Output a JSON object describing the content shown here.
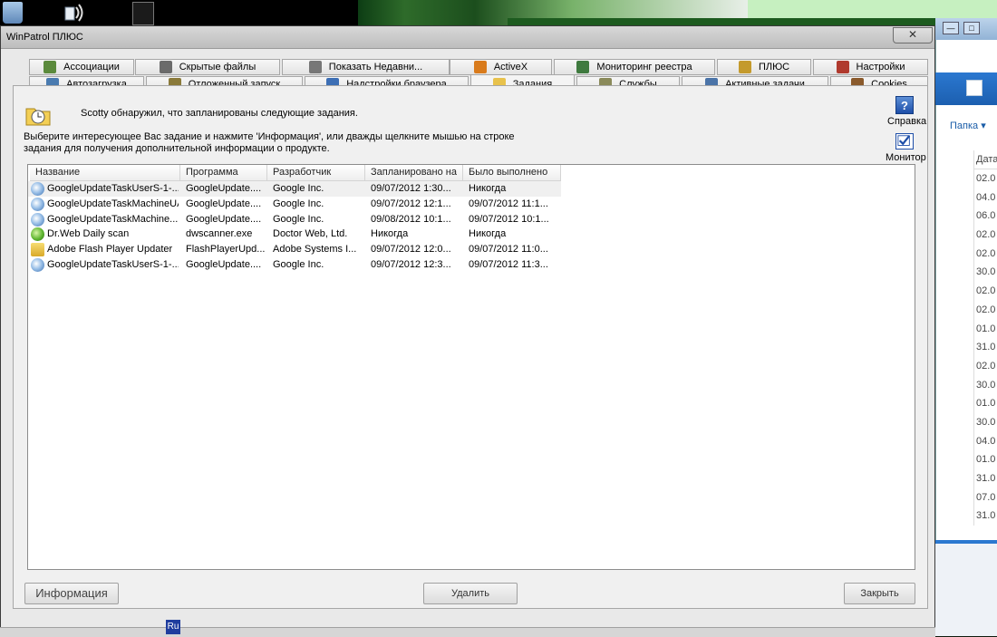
{
  "window": {
    "title": "WinPatrol ПЛЮС",
    "close_glyph": "✕"
  },
  "tabs_row1": [
    {
      "label": "Ассоциации",
      "icon": "associations-icon",
      "color": "#5b8a3c"
    },
    {
      "label": "Скрытые файлы",
      "icon": "hidden-files-icon",
      "color": "#6b6b6b"
    },
    {
      "label": "Показать Недавни...",
      "icon": "recent-icon",
      "color": "#777777"
    },
    {
      "label": "ActiveX",
      "icon": "activex-icon",
      "color": "#d97b1c"
    },
    {
      "label": "Мониторинг реестра",
      "icon": "registry-icon",
      "color": "#3f7a3f"
    },
    {
      "label": "ПЛЮС",
      "icon": "plus-icon",
      "color": "#c49a2c"
    },
    {
      "label": "Настройки",
      "icon": "settings-icon",
      "color": "#b03a2e"
    }
  ],
  "tabs_row2": [
    {
      "label": "Автозагрузка",
      "icon": "startup-icon",
      "color": "#4a7bb0"
    },
    {
      "label": "Отложенный запуск",
      "icon": "delayed-start-icon",
      "color": "#8a7a3a"
    },
    {
      "label": "Надстройки браузера",
      "icon": "browser-addons-icon",
      "color": "#3d6fb5"
    },
    {
      "label": "Задания",
      "icon": "tasks-icon",
      "color": "#e8c24c"
    },
    {
      "label": "Службы",
      "icon": "services-icon",
      "color": "#8a8a5a"
    },
    {
      "label": "Активные задачи",
      "icon": "active-tasks-icon",
      "color": "#4b74a8"
    },
    {
      "label": "Cookies",
      "icon": "cookies-icon",
      "color": "#8a5a2c"
    }
  ],
  "active_tab": "Задания",
  "header": {
    "scotty": "Scotty обнаружил, что запланированы следующие задания.",
    "instr_line1": "Выберите интересующее Вас задание и нажмите 'Информация', или дважды щелкните мышью на строке",
    "instr_line2": "задания для получения дополнительной информации о продукте."
  },
  "side": {
    "help_label": "Справка",
    "help_glyph": "?",
    "monitor_label": "Монитор"
  },
  "table": {
    "columns": [
      "Название",
      "Программа",
      "Разработчик",
      "Запланировано на",
      "Было выполнено"
    ],
    "rows": [
      {
        "name": "GoogleUpdateTaskUserS-1-...",
        "program": "GoogleUpdate....",
        "dev": "Google Inc.",
        "scheduled": "09/07/2012  1:30...",
        "done": "Никогда",
        "icon": "google-update-icon"
      },
      {
        "name": "GoogleUpdateTaskMachineUA",
        "program": "GoogleUpdate....",
        "dev": "Google Inc.",
        "scheduled": "09/07/2012  12:1...",
        "done": "09/07/2012  11:1...",
        "icon": "google-update-icon"
      },
      {
        "name": "GoogleUpdateTaskMachine...",
        "program": "GoogleUpdate....",
        "dev": "Google Inc.",
        "scheduled": "09/08/2012  10:1...",
        "done": "09/07/2012  10:1...",
        "icon": "google-update-icon"
      },
      {
        "name": "Dr.Web Daily scan",
        "program": "dwscanner.exe",
        "dev": "Doctor Web, Ltd.",
        "scheduled": "Никогда",
        "done": "Никогда",
        "icon": "drweb-icon"
      },
      {
        "name": "Adobe Flash Player Updater",
        "program": "FlashPlayerUpd...",
        "dev": "Adobe Systems I...",
        "scheduled": "09/07/2012  12:0...",
        "done": "09/07/2012  11:0...",
        "icon": "scheduled-task-icon"
      },
      {
        "name": "GoogleUpdateTaskUserS-1-...",
        "program": "GoogleUpdate....",
        "dev": "Google Inc.",
        "scheduled": "09/07/2012  12:3...",
        "done": "09/07/2012  11:3...",
        "icon": "google-update-icon"
      }
    ]
  },
  "buttons": {
    "info": "Информация",
    "delete": "Удалить",
    "close": "Закрыть"
  },
  "taskbar": {
    "lang": "Ru"
  },
  "background_explorer": {
    "folder_label": "Папка ▾",
    "date_header": "Дата",
    "dates": [
      "02.0",
      "04.0",
      "06.0",
      "02.0",
      "02.0",
      "30.0",
      "02.0",
      "02.0",
      "01.0",
      "31.0",
      "02.0",
      "30.0",
      "01.0",
      "30.0",
      "04.0",
      "01.0",
      "31.0",
      "07.0",
      "31.0"
    ],
    "ctrl_min": "—",
    "ctrl_max": "□"
  }
}
